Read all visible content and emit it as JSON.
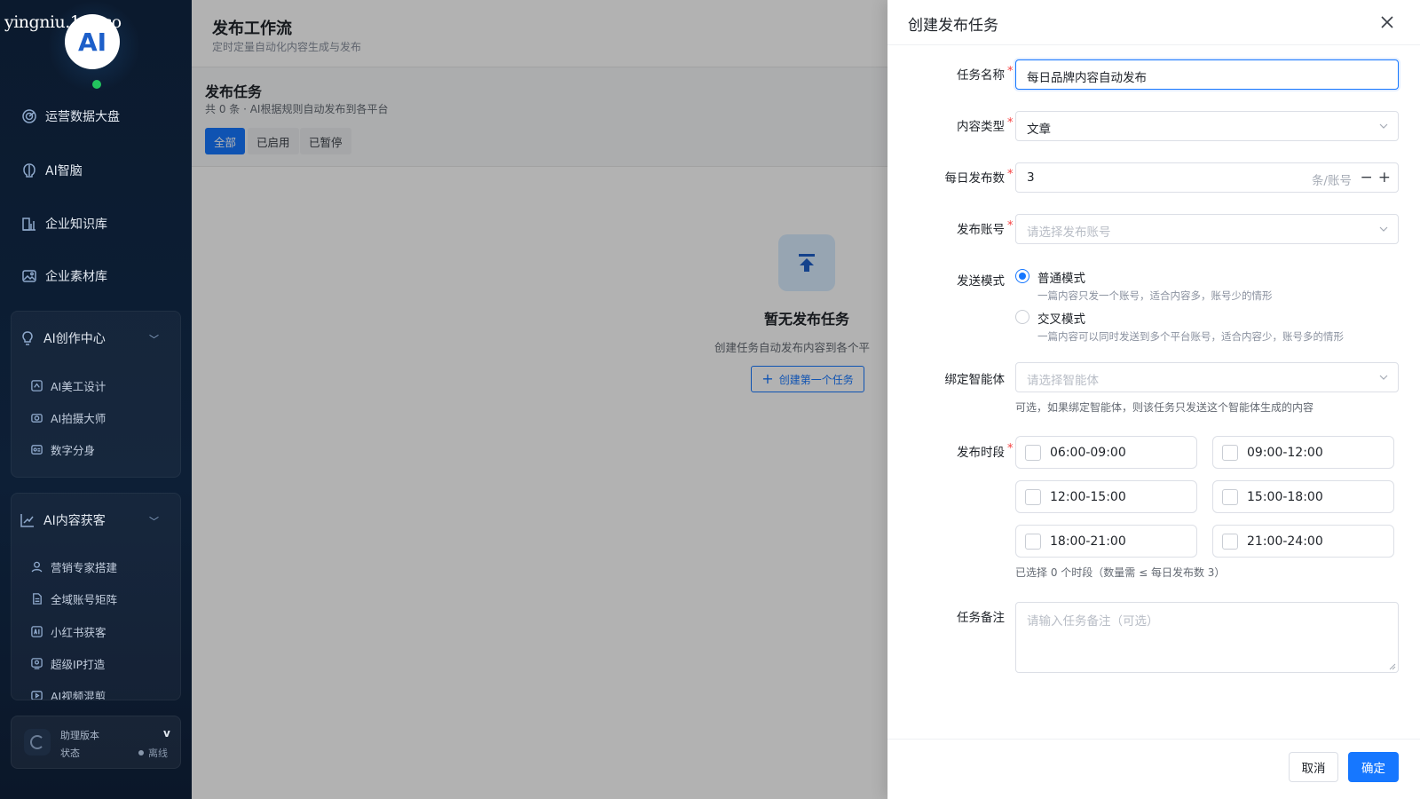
{
  "watermark": "yingniu.10v.co",
  "sidebar": {
    "logo_text": "AI",
    "nav": [
      {
        "label": "运营数据大盘",
        "icon": "radar-icon"
      },
      {
        "label": "AI智脑",
        "icon": "brain-icon"
      },
      {
        "label": "企业知识库",
        "icon": "building-chart-icon"
      },
      {
        "label": "企业素材库",
        "icon": "image-icon"
      }
    ],
    "groups": [
      {
        "label": "AI创作中心",
        "icon": "lightbulb-icon",
        "items": [
          {
            "label": "AI美工设计",
            "icon": "palette-icon"
          },
          {
            "label": "AI拍摄大师",
            "icon": "camera-icon"
          },
          {
            "label": "数字分身",
            "icon": "id-card-icon"
          }
        ]
      },
      {
        "label": "AI内容获客",
        "icon": "trend-chart-icon",
        "items": [
          {
            "label": "营销专家搭建",
            "icon": "user-icon"
          },
          {
            "label": "全域账号矩阵",
            "icon": "file-icon"
          },
          {
            "label": "小红书获客",
            "icon": "ai-box-icon"
          },
          {
            "label": "超级IP打造",
            "icon": "badge-icon"
          },
          {
            "label": "AI视频混剪",
            "icon": "video-icon"
          }
        ]
      }
    ],
    "status": {
      "line1": "助理版本",
      "line2": "状态",
      "version": "v",
      "state": "离线"
    }
  },
  "main": {
    "title": "发布工作流",
    "subtitle": "定时定量自动化内容生成与发布",
    "section_title": "发布任务",
    "section_sub": "共 0 条 · AI根据规则自动发布到各平台",
    "filters": [
      "全部",
      "已启用",
      "已暂停"
    ],
    "empty_title": "暂无发布任务",
    "empty_desc": "创建任务自动发布内容到各个平",
    "empty_button": "创建第一个任务"
  },
  "drawer": {
    "title": "创建发布任务",
    "fields": {
      "task_name": {
        "label": "任务名称",
        "value": "每日品牌内容自动发布"
      },
      "content_type": {
        "label": "内容类型",
        "value": "文章"
      },
      "daily_count": {
        "label": "每日发布数",
        "value": "3",
        "unit": "条/账号",
        "minus": "−",
        "plus": "+"
      },
      "account": {
        "label": "发布账号",
        "placeholder": "请选择发布账号"
      },
      "send_mode": {
        "label": "发送模式",
        "options": [
          {
            "title": "普通模式",
            "desc": "一篇内容只发一个账号，适合内容多，账号少的情形",
            "selected": true
          },
          {
            "title": "交叉模式",
            "desc": "一篇内容可以同时发送到多个平台账号，适合内容少，账号多的情形",
            "selected": false
          }
        ]
      },
      "agent": {
        "label": "绑定智能体",
        "placeholder": "请选择智能体",
        "help": "可选，如果绑定智能体，则该任务只发送这个智能体生成的内容"
      },
      "time_slots": {
        "label": "发布时段",
        "slots": [
          "06:00-09:00",
          "09:00-12:00",
          "12:00-15:00",
          "15:00-18:00",
          "18:00-21:00",
          "21:00-24:00"
        ],
        "help": "已选择 0 个时段（数量需 ≤ 每日发布数 3）"
      },
      "note": {
        "label": "任务备注",
        "placeholder": "请输入任务备注（可选）"
      }
    },
    "cancel": "取消",
    "confirm": "确定"
  },
  "colors": {
    "primary": "#1677ff",
    "sidebar_bg": "#0b1a2e",
    "required": "#f53f3f",
    "online": "#22c55e"
  }
}
